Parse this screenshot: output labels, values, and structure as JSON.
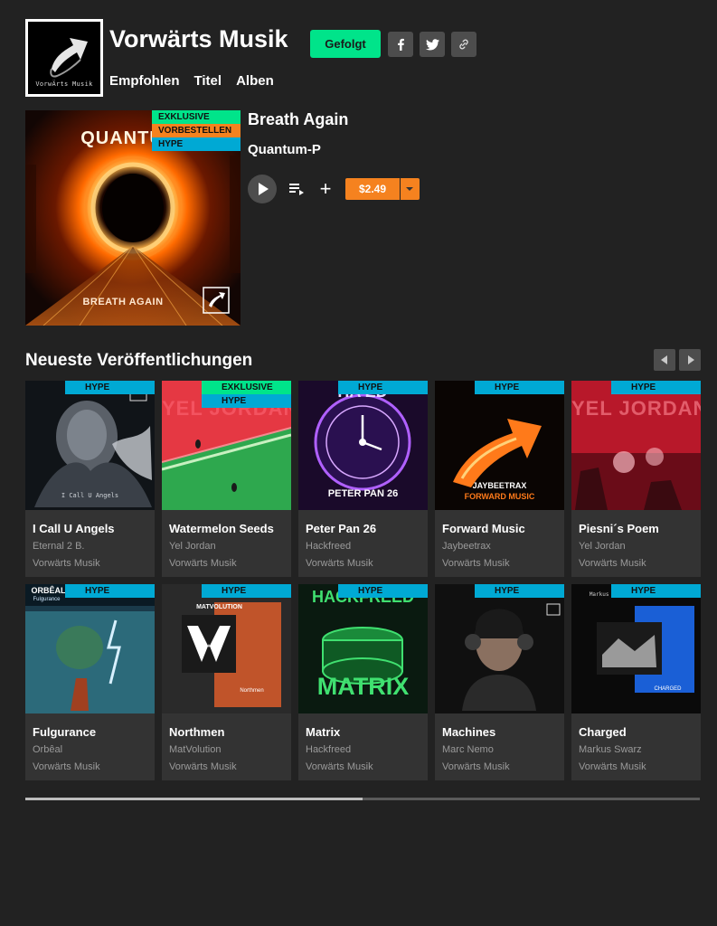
{
  "header": {
    "logo_text": "VorwÄrts Musik",
    "label_name": "Vorwärts Musik",
    "follow_label": "Gefolgt",
    "social": [
      "facebook-icon",
      "twitter-icon",
      "link-icon"
    ],
    "nav": [
      "Empfohlen",
      "Titel",
      "Alben"
    ]
  },
  "featured": {
    "title": "Breath Again",
    "artist": "Quantum-P",
    "art_title": "QUANTU",
    "art_subtitle": "BREATH AGAIN",
    "badges": [
      "EXKLUSIVE",
      "VORBESTELLEN",
      "HYPE"
    ],
    "price": "$2.49"
  },
  "releases": {
    "title": "Neueste Veröffentlichungen",
    "items": [
      {
        "title": "I Call U Angels",
        "artist": "Eternal 2 B.",
        "label": "Vorwärts Musik",
        "badges": [
          "HYPE"
        ],
        "art_text": "I Call U Angels"
      },
      {
        "title": "Watermelon Seeds",
        "artist": "Yel Jordan",
        "label": "Vorwärts Musik",
        "badges": [
          "EXKLUSIVE",
          "HYPE"
        ],
        "art_text": "YEL JORDAN"
      },
      {
        "title": "Peter Pan 26",
        "artist": "Hackfreed",
        "label": "Vorwärts Musik",
        "badges": [
          "HYPE"
        ],
        "art_text": "PETER PAN 26"
      },
      {
        "title": "Forward Music",
        "artist": "Jaybeetrax",
        "label": "Vorwärts Musik",
        "badges": [
          "HYPE"
        ],
        "art_text": "JAYBEETRAX",
        "art_text2": "FORWARD MUSIC"
      },
      {
        "title": "Piesni´s Poem",
        "artist": "Yel Jordan",
        "label": "Vorwärts Musik",
        "badges": [
          "HYPE"
        ],
        "art_text": "YEL JORDAN"
      },
      {
        "title": "Fulgurance",
        "artist": "Orbêal",
        "label": "Vorwärts Musik",
        "badges": [
          "HYPE"
        ],
        "art_text": "ORBÊAL",
        "art_text2": "Fulgurance"
      },
      {
        "title": "Northmen",
        "artist": "MatVolution",
        "label": "Vorwärts Musik",
        "badges": [
          "HYPE"
        ],
        "art_text": "MATVOLUTION",
        "art_text2": "Northmen"
      },
      {
        "title": "Matrix",
        "artist": "Hackfreed",
        "label": "Vorwärts Musik",
        "badges": [
          "HYPE"
        ],
        "art_text": "HACKFREED",
        "art_text2": "MATRIX"
      },
      {
        "title": "Machines",
        "artist": "Marc Nemo",
        "label": "Vorwärts Musik",
        "badges": [
          "HYPE"
        ]
      },
      {
        "title": "Charged",
        "artist": "Markus Swarz",
        "label": "Vorwärts Musik",
        "badges": [
          "HYPE"
        ],
        "art_text": "Markus Swarz",
        "art_text2": "CHARGED"
      }
    ]
  },
  "scrollbar": {
    "position_fraction": 0.5
  },
  "colors": {
    "accent_green": "#00e48a",
    "accent_orange": "#f5821f",
    "accent_blue": "#00a9d4",
    "background": "#222222",
    "card": "#333333"
  }
}
